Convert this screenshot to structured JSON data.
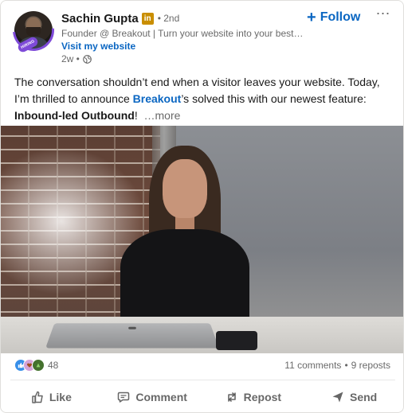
{
  "post": {
    "author": {
      "name": "Sachin Gupta",
      "badge": "in",
      "degree": "• 2nd",
      "headline": "Founder @ Breakout | Turn your website into your best…",
      "link_label": "Visit my website",
      "time": "2w •",
      "avatar_label": "HIRING"
    },
    "follow_label": "Follow",
    "more_label": "⋯",
    "text": {
      "line1": "The conversation shouldn’t end when a visitor leaves your website. Today,",
      "line2_prefix": "I’m thrilled to announce ",
      "mention": "Breakout",
      "line2_suffix": "’s solved this with our newest feature:",
      "bold": "Inbound-led Outbound",
      "after_bold": "!",
      "see_more": "…more"
    },
    "social": {
      "reaction_count": "48",
      "comments": "11 comments",
      "separator": "•",
      "reposts": "9 reposts"
    },
    "actions": {
      "like": "Like",
      "comment": "Comment",
      "repost": "Repost",
      "send": "Send"
    }
  },
  "colors": {
    "link_blue": "#0a66c2",
    "linkedin_badge": "#c98e00",
    "hiring_ring": "#7e4ad8"
  },
  "icons": {
    "globe": "globe-icon",
    "like": "thumbs-up-icon",
    "comment": "comment-bubble-icon",
    "repost": "repost-arrows-icon",
    "send": "send-paper-plane-icon"
  }
}
